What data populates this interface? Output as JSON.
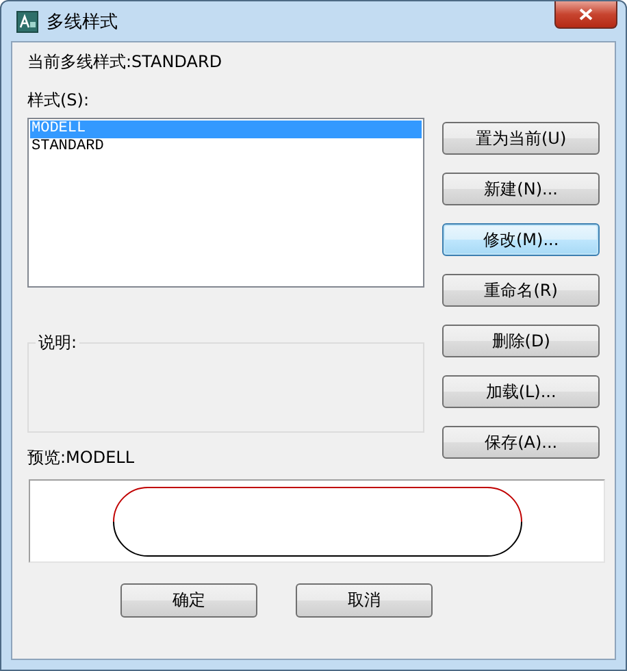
{
  "window": {
    "title": "多线样式"
  },
  "current_style": "当前多线样式:STANDARD",
  "styles": {
    "label": "样式(S):",
    "items": [
      {
        "label": "MODELL",
        "selected": true
      },
      {
        "label": "STANDARD",
        "selected": false
      }
    ]
  },
  "side_buttons": [
    {
      "label": "置为当前(U)",
      "focused": false
    },
    {
      "label": "新建(N)...",
      "focused": false
    },
    {
      "label": "修改(M)...",
      "focused": true
    },
    {
      "label": "重命名(R)",
      "focused": false
    },
    {
      "label": "删除(D)",
      "focused": false
    },
    {
      "label": "加载(L)...",
      "focused": false
    },
    {
      "label": "保存(A)...",
      "focused": false
    }
  ],
  "description": {
    "label": "说明:"
  },
  "preview": {
    "label": "预览:MODELL"
  },
  "buttons": [
    "确定",
    "取消"
  ]
}
